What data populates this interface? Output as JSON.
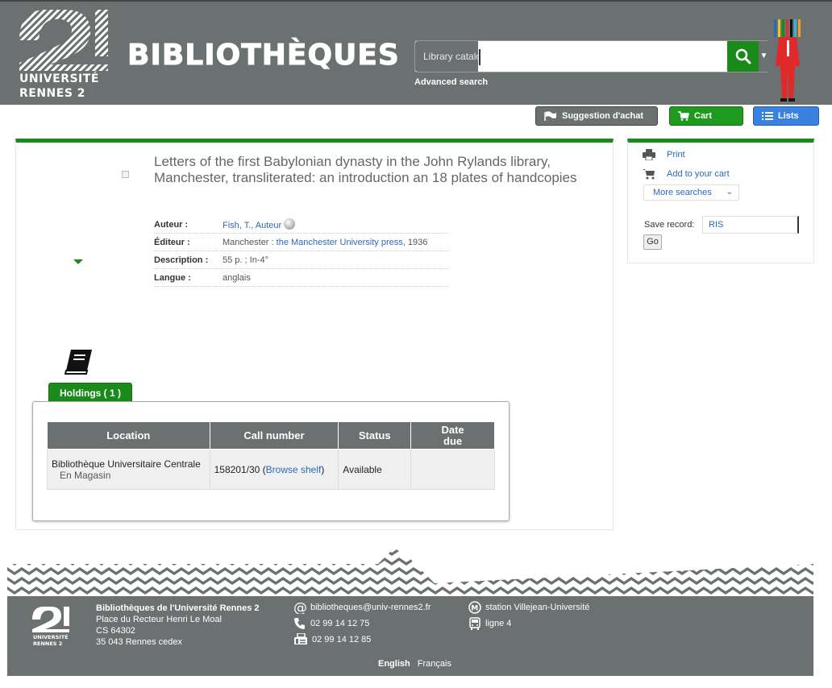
{
  "header": {
    "univ_line1": "UNIVERSITÉ",
    "univ_line2": "RENNES 2",
    "brand_title": "BIBLIOTHÈQUES",
    "search": {
      "type_label": "Library catalog",
      "placeholder": "",
      "value": ""
    },
    "advanced_search": "Advanced search"
  },
  "toolbar": {
    "suggestion": "Suggestion d'achat",
    "cart": "Cart",
    "lists": "Lists"
  },
  "record": {
    "title": "Letters of the first Babylonian dynasty in the John Rylands library, Manchester, transliterated: an introduction an 18 plates of handcopies",
    "author_label": "Auteur :",
    "author_value": "Fish, T., Auteur",
    "publisher_label": "Éditeur :",
    "publisher_place": "Manchester : ",
    "publisher_name": "the Manchester University press",
    "publisher_year": ", 1936",
    "description_label": "Description :",
    "description_value": "55 p. ; In-4°",
    "language_label": "Langue :",
    "language_value": "anglais"
  },
  "holdings": {
    "tab_label": "Holdings ( 1 )",
    "columns": [
      "Location",
      "Call number",
      "Status",
      "Date due"
    ],
    "rows": [
      {
        "location": "Bibliothèque Universitaire Centrale",
        "shelving": "En Magasin",
        "call_number": "158201/30 (",
        "browse_shelf": "Browse shelf",
        "call_suffix": ")",
        "status": "Available",
        "date_due": ""
      }
    ]
  },
  "sidebar": {
    "print": "Print",
    "add_to_cart": "Add to your cart",
    "more_searches": "More searches",
    "save_record_label": "Save record:",
    "save_format": "RIS",
    "go": "Go"
  },
  "footer": {
    "logo_line1": "UNIVERSITÉ",
    "logo_line2": "RENNES 2",
    "org_name": "Bibliothèques de l'Université Rennes 2",
    "address_line1": "Place du Recteur Henri Le Moal",
    "address_line2": "CS 64302",
    "address_line3": "35 043 Rennes cedex",
    "email": "bibliotheques@univ-rennes2.fr",
    "phone": "02 99 14 12 75",
    "fax": "02 99 14 12 85",
    "metro": "station Villejean-Université",
    "bus": "ligne 4",
    "lang_en": "English",
    "lang_fr": "Français"
  },
  "colors": {
    "header_gray": "#6b7071",
    "accent_green": "#1a8a1a",
    "lists_blue": "#3b82e0",
    "link_blue": "#2a6ab8"
  }
}
